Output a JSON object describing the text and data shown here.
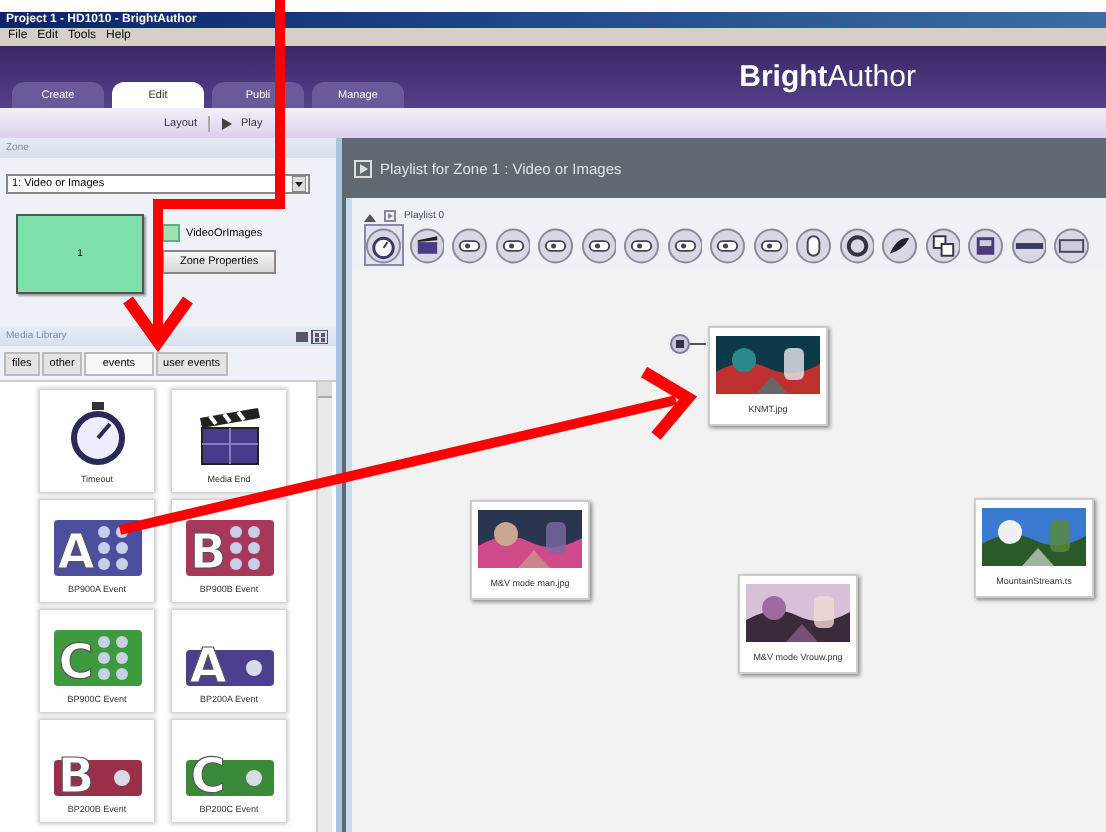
{
  "window": {
    "title": "Project 1 - HD1010 - BrightAuthor"
  },
  "menu": [
    "File",
    "Edit",
    "Tools",
    "Help"
  ],
  "tabs": [
    {
      "label": "Create",
      "selected": false
    },
    {
      "label": "Edit",
      "selected": true
    },
    {
      "label": "Publi",
      "selected": false
    },
    {
      "label": "Manage",
      "selected": false
    }
  ],
  "logo": "**Bright**Author",
  "subnav": [
    "Layout",
    "Play"
  ],
  "zone": {
    "heading": "Zone",
    "dropdown": "1: Video or Images",
    "preview_label": "1",
    "checkbox": {
      "label": "VideoOrImages",
      "checked": true
    },
    "button": "Zone Properties"
  },
  "media_library": {
    "heading": "Media Library",
    "tabs": [
      {
        "label": "files",
        "selected": false
      },
      {
        "label": "other",
        "selected": false
      },
      {
        "label": "events",
        "selected": true
      },
      {
        "label": "user events",
        "selected": false
      }
    ],
    "items": [
      {
        "kind": "timer",
        "label": "Timeout"
      },
      {
        "kind": "clapper",
        "label": "Media End"
      },
      {
        "kind": "letter-tile",
        "label": "BP900A Event",
        "letter": "A",
        "color": "#4b4f9e"
      },
      {
        "kind": "letter-tile",
        "label": "BP900B Event",
        "letter": "B",
        "color": "#a8385a"
      },
      {
        "kind": "letter-tile",
        "label": "BP900C Event",
        "letter": "C",
        "color": "#3f9a3f"
      },
      {
        "kind": "small-letter-tile",
        "label": "BP200A Event",
        "letter": "A",
        "color": "#4b3f8e"
      },
      {
        "kind": "small-letter-tile",
        "label": "BP200B Event",
        "letter": "B",
        "color": "#9a2f4a"
      },
      {
        "kind": "small-letter-tile",
        "label": "BP200C Event",
        "letter": "C",
        "color": "#3a8a3a"
      }
    ]
  },
  "playlist": {
    "header": "Playlist for Zone 1 : Video or Images",
    "name": "Playlist 0",
    "expanded": true,
    "toolbar": [
      {
        "selected": true
      },
      {
        "selected": false
      },
      {
        "selected": false
      },
      {
        "selected": false
      },
      {
        "selected": false
      },
      {
        "selected": false
      },
      {
        "selected": false
      },
      {
        "selected": false
      },
      {
        "selected": false
      },
      {
        "selected": false
      },
      {
        "selected": false
      },
      {
        "selected": false
      },
      {
        "selected": false
      },
      {
        "selected": false
      },
      {
        "selected": false
      },
      {
        "selected": false
      },
      {
        "selected": false
      }
    ],
    "nodes": [
      {
        "label": "KNMT.jpg",
        "initial": true
      },
      {
        "label": "M&V mode man.jpg",
        "initial": false
      },
      {
        "label": "M&V mode Vrouw.png",
        "initial": false
      },
      {
        "label": "MountainStream.ts",
        "initial": false
      }
    ]
  },
  "annotations": [
    {
      "kind": "arrow"
    },
    {
      "kind": "arrow"
    }
  ]
}
